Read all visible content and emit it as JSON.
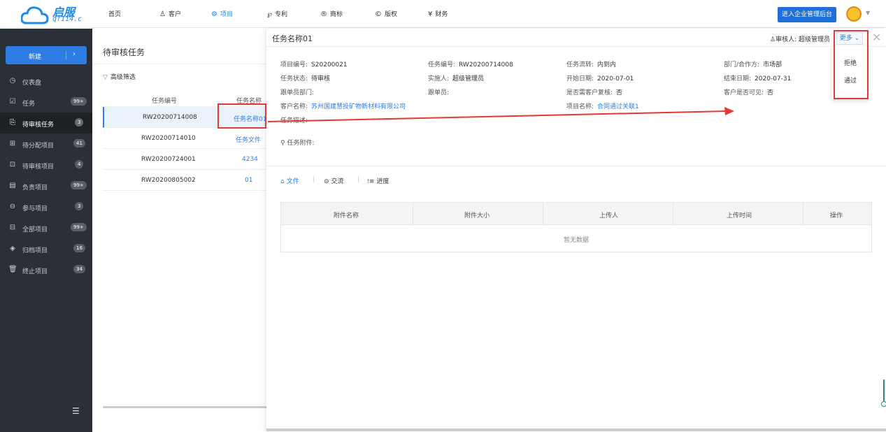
{
  "brand": {
    "name": "启服",
    "url": "qf114.c"
  },
  "nav": [
    {
      "label": "首页",
      "icon": ""
    },
    {
      "label": "客户",
      "icon": "user-group-icon"
    },
    {
      "label": "项目",
      "icon": "project-icon",
      "active": true
    },
    {
      "label": "专利",
      "icon": "patent-icon"
    },
    {
      "label": "商标",
      "icon": "registered-icon"
    },
    {
      "label": "版权",
      "icon": "copyright-icon"
    },
    {
      "label": "财务",
      "icon": "finance-icon"
    }
  ],
  "header": {
    "admin_button": "进入企业管理后台"
  },
  "sidebar": {
    "new_button": "新建",
    "items": [
      {
        "label": "仪表盘",
        "icon": "dashboard-icon",
        "badge": ""
      },
      {
        "label": "任务",
        "icon": "task-icon",
        "badge": "99+"
      },
      {
        "label": "待审核任务",
        "icon": "review-task-icon",
        "badge": "3",
        "active": true
      },
      {
        "label": "待分配项目",
        "icon": "assign-icon",
        "badge": "41"
      },
      {
        "label": "待审核项目",
        "icon": "review-project-icon",
        "badge": "4"
      },
      {
        "label": "负责项目",
        "icon": "responsible-icon",
        "badge": "99+"
      },
      {
        "label": "参与项目",
        "icon": "participate-icon",
        "badge": "3"
      },
      {
        "label": "全部项目",
        "icon": "all-projects-icon",
        "badge": "99+"
      },
      {
        "label": "归档项目",
        "icon": "archive-icon",
        "badge": "16"
      },
      {
        "label": "终止项目",
        "icon": "trash-icon",
        "badge": "34"
      }
    ]
  },
  "list": {
    "title": "待审核任务",
    "filter": "高级筛选",
    "columns": [
      "任务编号",
      "任务名称"
    ],
    "rows": [
      {
        "no": "RW20200714008",
        "name": "任务名称01"
      },
      {
        "no": "RW20200714010",
        "name": "任务文件"
      },
      {
        "no": "RW20200724001",
        "name": "4234"
      },
      {
        "no": "RW20200805002",
        "name": "01"
      }
    ]
  },
  "detail": {
    "title": "任务名称01",
    "reviewer": "审核人: 超级管理员",
    "more": "更多",
    "fields": {
      "project_no": {
        "label": "项目编号:",
        "value": "S20200021"
      },
      "task_no": {
        "label": "任务编号:",
        "value": "RW20200714008"
      },
      "task_flow": {
        "label": "任务流转:",
        "value": "内到内"
      },
      "dept": {
        "label": "部门/合作方:",
        "value": "市场部"
      },
      "task_status": {
        "label": "任务状态:",
        "value": "待审核"
      },
      "assignee": {
        "label": "实施人:",
        "value": "超级管理员"
      },
      "start_date": {
        "label": "开始日期:",
        "value": "2020-07-01"
      },
      "end_date": {
        "label": "结束日期:",
        "value": "2020-07-31"
      },
      "follow_dept": {
        "label": "跟单员部门:",
        "value": ""
      },
      "follower": {
        "label": "跟单员:",
        "value": ""
      },
      "client_review": {
        "label": "是否需客户复核:",
        "value": "否"
      },
      "client_visible": {
        "label": "客户是否可见:",
        "value": "否"
      },
      "client_name": {
        "label": "客户名称:",
        "value": "苏州国建慧投矿物新材料有限公司"
      },
      "project_name": {
        "label": "项目名称:",
        "value": "合同通过关联1"
      },
      "description": {
        "label": "任务描述:"
      },
      "attachments": {
        "label": "任务附件:"
      }
    },
    "tabs": [
      "文件",
      "交流",
      "进度"
    ],
    "table": {
      "columns": [
        "附件名称",
        "附件大小",
        "上传人",
        "上传时间",
        "操作"
      ],
      "empty": "暂无数据"
    }
  },
  "dropdown": {
    "items": [
      "拒绝",
      "通过"
    ]
  },
  "colors": {
    "accent": "#2d7de4",
    "sidebar": "#2b3036",
    "annotation": "#e53935"
  }
}
